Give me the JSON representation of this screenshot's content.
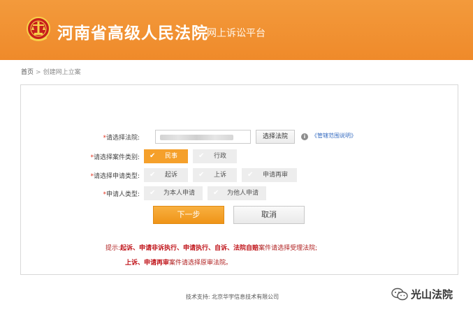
{
  "header": {
    "title": "河南省高级人民法院",
    "subtitle": "网上诉讼平台",
    "accent_color": "#ef8a2a"
  },
  "breadcrumb": {
    "home": "首页",
    "separator": ">",
    "current": "创建网上立案"
  },
  "form": {
    "court": {
      "required_mark": "*",
      "label": "请选择法院:",
      "value": "",
      "choose_button": "选择法院",
      "info_icon": "info-icon",
      "scope_link": "《管辖范围说明》"
    },
    "case_type": {
      "required_mark": "*",
      "label": "请选择案件类别:",
      "options": [
        {
          "label": "民事",
          "selected": true
        },
        {
          "label": "行政",
          "selected": false
        }
      ]
    },
    "apply_type": {
      "required_mark": "*",
      "label": "请选择申请类型:",
      "options": [
        {
          "label": "起诉",
          "selected": false
        },
        {
          "label": "上诉",
          "selected": false
        },
        {
          "label": "申请再审",
          "selected": false
        }
      ]
    },
    "applicant_type": {
      "required_mark": "*",
      "label": "申请人类型:",
      "options": [
        {
          "label": "为本人申请",
          "selected": false
        },
        {
          "label": "为他人申请",
          "selected": false
        }
      ]
    },
    "next_button": "下一步",
    "cancel_button": "取消",
    "selected_color": "#f5a02b"
  },
  "tips": {
    "line1_prefix": "提示:",
    "line1_bold": "起诉、申请非诉执行、申请执行、自诉、法院自赔",
    "line1_rest": "案件请选择受理法院;",
    "line2_bold": "上诉、申请再审",
    "line2_rest": "案件请选择原审法院。"
  },
  "footer": {
    "text": "技术支持: 北京华宇信息技术有限公司"
  },
  "watermark": {
    "text": "光山法院",
    "icon": "wechat-icon"
  }
}
